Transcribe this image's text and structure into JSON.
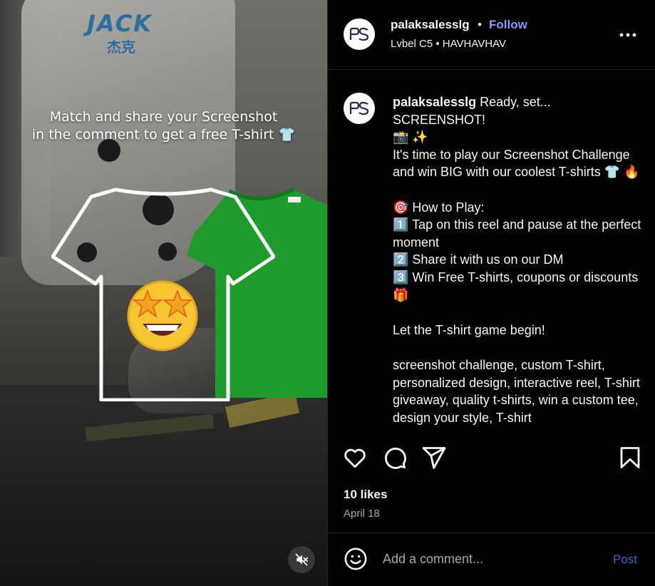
{
  "media": {
    "brand_text": "JACK",
    "brand_sub": "杰克",
    "caption_line1": "Match and share your Screenshot",
    "caption_line2": "in the comment to get a free T-shirt 👕",
    "mute_icon": "speaker-muted-icon",
    "colors": {
      "green_shirt": "#1f9a2c",
      "brand_blue": "#2c6e9e"
    }
  },
  "header": {
    "username": "palaksalesslg",
    "dot": "•",
    "follow_label": "Follow",
    "subtitle": "Lvbel C5 • HAVHAVHAV",
    "more_icon": "more-options-icon"
  },
  "caption": {
    "username": "palaksalesslg",
    "text": " Ready, set... SCREENSHOT!\n📸 ✨\nIt's time to play our Screenshot Challenge and win BIG with our coolest T-shirts 👕 🔥\n\n🎯 How to Play:\n1️⃣ Tap on this reel and pause at the perfect moment\n2️⃣ Share it with us on our DM\n3️⃣ Win Free T-shirts, coupons or discounts 🎁\n\nLet the T-shirt game begin!\n\nscreenshot challenge, custom T-shirt, personalized design, interactive reel, T-shirt giveaway, quality t-shirts, win a custom tee, design your style, T-shirt"
  },
  "actions": {
    "likes": "10 likes",
    "date": "April 18",
    "icons": [
      "heart-icon",
      "comment-icon",
      "share-icon",
      "bookmark-icon"
    ]
  },
  "add_comment": {
    "placeholder": "Add a comment...",
    "post_label": "Post",
    "emoji_icon": "smiley-icon"
  },
  "accent": {
    "follow": "#8a9bff",
    "post": "#4a5dd9"
  }
}
